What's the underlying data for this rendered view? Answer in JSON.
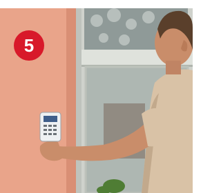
{
  "step": {
    "number": "5"
  },
  "colors": {
    "badge": "#d8192a",
    "wall": "#e9a48a",
    "door_frame": "#cfd2cc",
    "glass": "#aeb7b2",
    "shirt": "#d9c2a6",
    "skin": "#c98d6a",
    "keypad": "#eef1f3"
  },
  "scene": {
    "description_icon": "person-scanning-fingerprint-at-door-keypad"
  }
}
